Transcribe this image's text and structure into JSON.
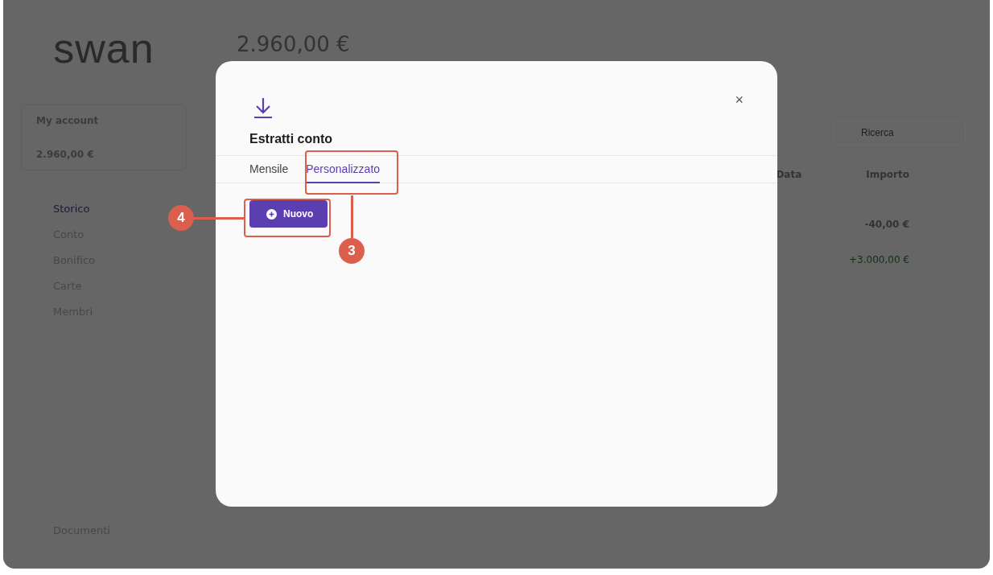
{
  "app": {
    "logo": "swan",
    "account": {
      "name": "My account",
      "balance": "2.960,00 €"
    },
    "nav": [
      {
        "label": "Storico",
        "selected": true
      },
      {
        "label": "Conto",
        "selected": false
      },
      {
        "label": "Bonifico",
        "selected": false
      },
      {
        "label": "Carte",
        "selected": false
      },
      {
        "label": "Membri",
        "selected": false
      }
    ],
    "footer_link": "Documenti",
    "header_balance": "2.960,00 €",
    "search": {
      "placeholder": "Ricerca"
    },
    "columns": [
      "Data",
      "Importo"
    ],
    "rows": [
      {
        "amount": "-40,00 €",
        "kind": "debit"
      },
      {
        "amount": "+3.000,00 €",
        "kind": "credit"
      }
    ]
  },
  "modal": {
    "title": "Estratti conto",
    "close": "×",
    "tabs": [
      {
        "label": "Mensile",
        "selected": false
      },
      {
        "label": "Personalizzato",
        "selected": true
      }
    ],
    "button": "Nuovo"
  },
  "annotations": [
    {
      "number": "3"
    },
    {
      "number": "4"
    }
  ]
}
